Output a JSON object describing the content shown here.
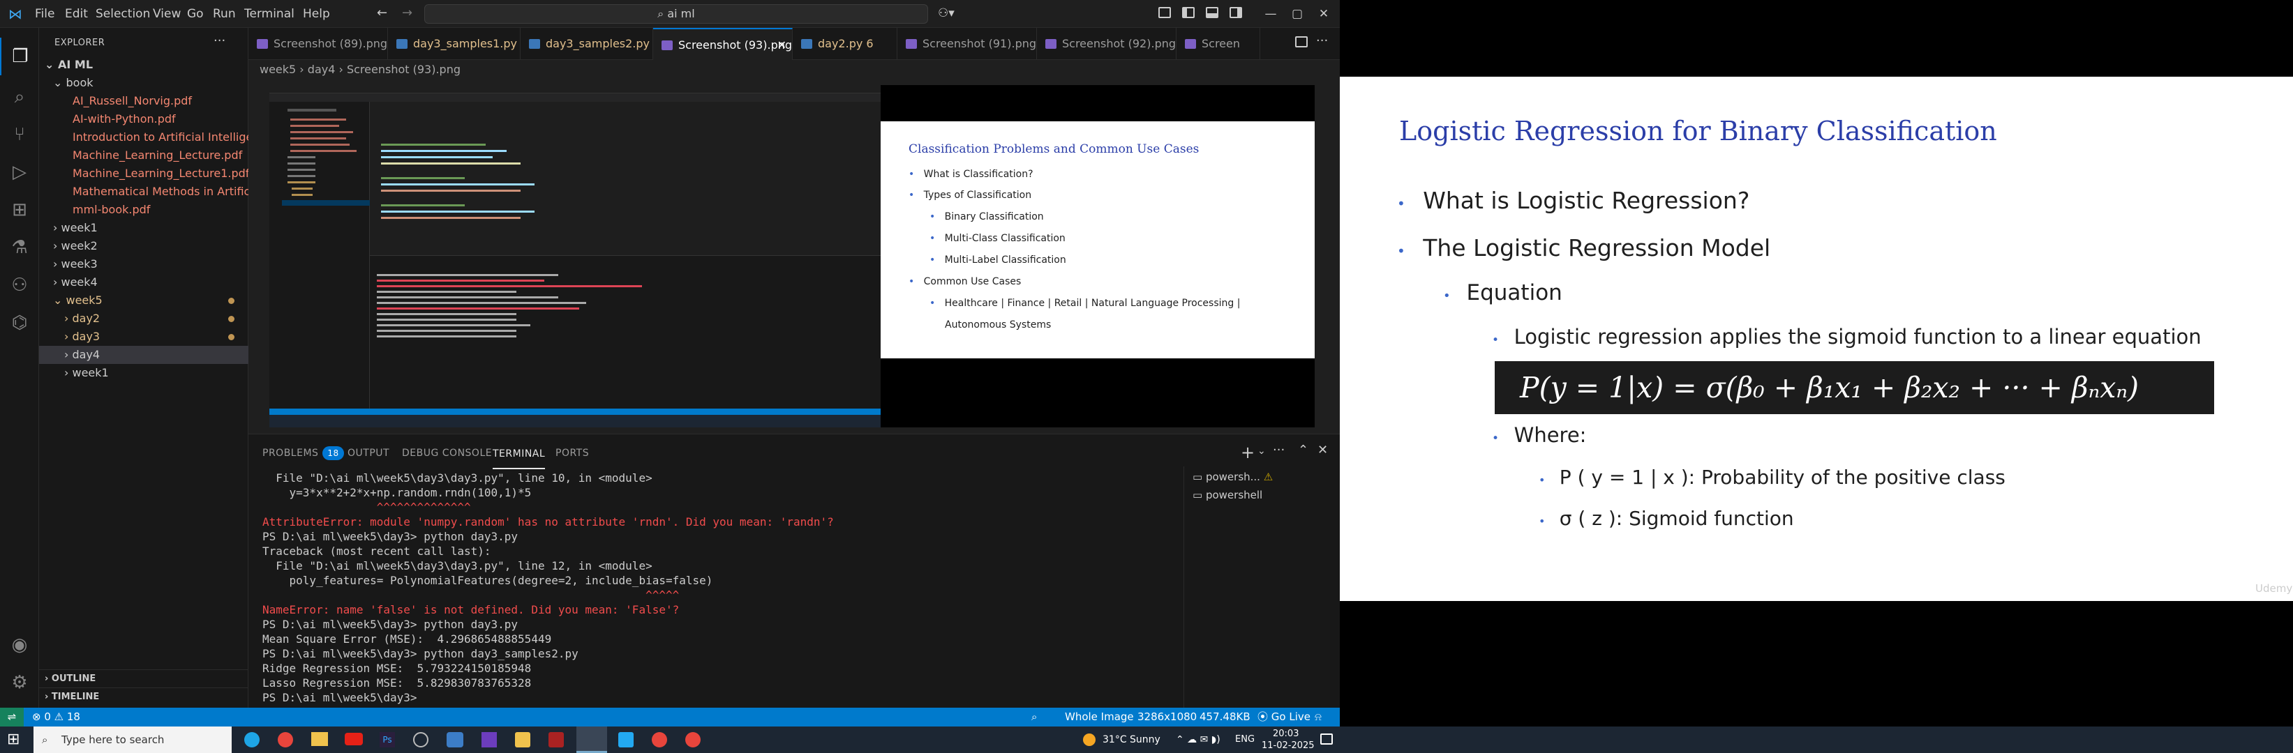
{
  "menu": [
    "File",
    "Edit",
    "Selection",
    "View",
    "Go",
    "Run",
    "Terminal",
    "Help"
  ],
  "search": {
    "text": "ai ml"
  },
  "explorer": {
    "title": "EXPLORER",
    "root": "AI ML",
    "book": "book",
    "files": [
      "AI_Russell_Norvig.pdf",
      "AI-with-Python.pdf",
      "Introduction to Artificial Intelligen...",
      "Machine_Learning_Lecture.pdf",
      "Machine_Learning_Lecture1.pdf",
      "Mathematical Methods in Artificia...",
      "mml-book.pdf"
    ],
    "folders": [
      "week1",
      "week2",
      "week3",
      "week4"
    ],
    "week5": "week5",
    "week5_children": [
      "day2",
      "day3",
      "day4",
      "week1"
    ],
    "outline": "OUTLINE",
    "timeline": "TIMELINE"
  },
  "tabs": [
    {
      "label": "Screenshot (89).png",
      "type": "img"
    },
    {
      "label": "day3_samples1.py  5",
      "type": "py"
    },
    {
      "label": "day3_samples2.py  7",
      "type": "py"
    },
    {
      "label": "Screenshot (93).png",
      "type": "img",
      "active": true
    },
    {
      "label": "day2.py  6",
      "type": "py"
    },
    {
      "label": "Screenshot (91).png",
      "type": "img"
    },
    {
      "label": "Screenshot (92).png",
      "type": "img"
    },
    {
      "label": "Screen",
      "type": "img"
    }
  ],
  "breadcrumb": "week5  ›  day4  ›   Screenshot (93).png",
  "preview_slide": {
    "title": "Classification Problems and Common Use Cases",
    "items": [
      {
        "text": "What is Classification?",
        "level": 1
      },
      {
        "text": "Types of Classification",
        "level": 1
      },
      {
        "text": "Binary Classification",
        "level": 2
      },
      {
        "text": "Multi-Class Classification",
        "level": 2
      },
      {
        "text": "Multi-Label Classification",
        "level": 2
      },
      {
        "text": "Common Use Cases",
        "level": 1
      },
      {
        "text": "Healthcare | Finance | Retail | Natural Language Processing |",
        "level": 2
      },
      {
        "text": "Autonomous Systems",
        "level": 2
      }
    ]
  },
  "panel": {
    "tabs": [
      "PROBLEMS",
      "OUTPUT",
      "DEBUG CONSOLE",
      "TERMINAL",
      "PORTS"
    ],
    "problems_count": "18",
    "shells": [
      "powersh...",
      "powershell"
    ]
  },
  "terminal": [
    {
      "t": "  File \"D:\\ai ml\\week5\\day3\\day3.py\", line 10, in <module>",
      "c": ""
    },
    {
      "t": "    y=3*x**2+2*x+np.random.rndn(100,1)*5",
      "c": ""
    },
    {
      "t": "                 ^^^^^^^^^^^^^^",
      "c": "t-red"
    },
    {
      "t": "AttributeError: module 'numpy.random' has no attribute 'rndn'. Did you mean: 'randn'?",
      "c": "t-err"
    },
    {
      "t": "PS D:\\ai ml\\week5\\day3> python day3.py",
      "c": ""
    },
    {
      "t": "Traceback (most recent call last):",
      "c": ""
    },
    {
      "t": "  File \"D:\\ai ml\\week5\\day3\\day3.py\", line 12, in <module>",
      "c": ""
    },
    {
      "t": "    poly_features= PolynomialFeatures(degree=2, include_bias=false)",
      "c": ""
    },
    {
      "t": "                                                         ^^^^^",
      "c": "t-red"
    },
    {
      "t": "NameError: name 'false' is not defined. Did you mean: 'False'?",
      "c": "t-err"
    },
    {
      "t": "PS D:\\ai ml\\week5\\day3> python day3.py",
      "c": ""
    },
    {
      "t": "Mean Square Error (MSE):  4.296865488855449",
      "c": ""
    },
    {
      "t": "PS D:\\ai ml\\week5\\day3> python day3_samples2.py",
      "c": ""
    },
    {
      "t": "Ridge Regression MSE:  5.793224150185948",
      "c": ""
    },
    {
      "t": "Lasso Regression MSE:  5.829830783765328",
      "c": ""
    },
    {
      "t": "PS D:\\ai ml\\week5\\day3> ",
      "c": ""
    }
  ],
  "status": {
    "errors": "⊗ 0  ⚠ 18",
    "image_mode": "Whole Image",
    "dimensions": "3286x1080",
    "size": "457.48KB",
    "golive": "Go Live"
  },
  "taskbar": {
    "search": "Type here to search",
    "weather": "31°C  Sunny",
    "lang": "ENG",
    "time": "20:03",
    "date": "11-02-2025"
  },
  "slide": {
    "title": "Logistic Regression for Binary Classification",
    "b1": "What is Logistic Regression?",
    "b2": "The Logistic Regression Model",
    "b3": "Equation",
    "b4": "Logistic regression applies the sigmoid function to a linear equation",
    "equation": "P(y = 1|x) = σ(β₀ + β₁x₁ + β₂x₂ + ··· + βₙxₙ)",
    "b5": "Where:",
    "b6": "P ( y = 1 | x ): Probability of the positive class",
    "b7": "σ ( z ): Sigmoid function",
    "watermark": "Udemy"
  },
  "colors": {
    "accent": "#0078d4",
    "status": "#007acc",
    "slide_title": "#2b3ea8"
  }
}
